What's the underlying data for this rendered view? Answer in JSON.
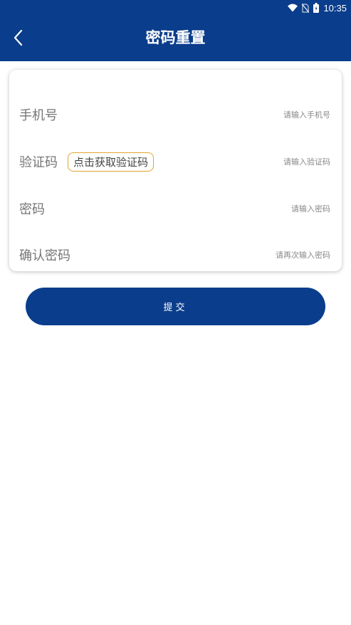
{
  "status_bar": {
    "time": "10:35",
    "icons": [
      "wifi-icon",
      "no-sim-icon",
      "battery-icon"
    ]
  },
  "header": {
    "title": "密码重置",
    "back_icon": "chevron-left-icon"
  },
  "form": {
    "phone": {
      "label": "手机号",
      "placeholder": "请输入手机号",
      "value": ""
    },
    "code": {
      "label": "验证码",
      "button_label": "点击获取验证码",
      "placeholder": "请输入验证码",
      "value": ""
    },
    "password": {
      "label": "密码",
      "placeholder": "请输入密码",
      "value": ""
    },
    "confirm_password": {
      "label": "确认密码",
      "placeholder": "请再次输入密码",
      "value": ""
    }
  },
  "submit_label": "提交",
  "colors": {
    "primary": "#0a3d8b",
    "code_button_border": "#e0a530",
    "label_text": "#757575",
    "placeholder_text": "#888888"
  }
}
